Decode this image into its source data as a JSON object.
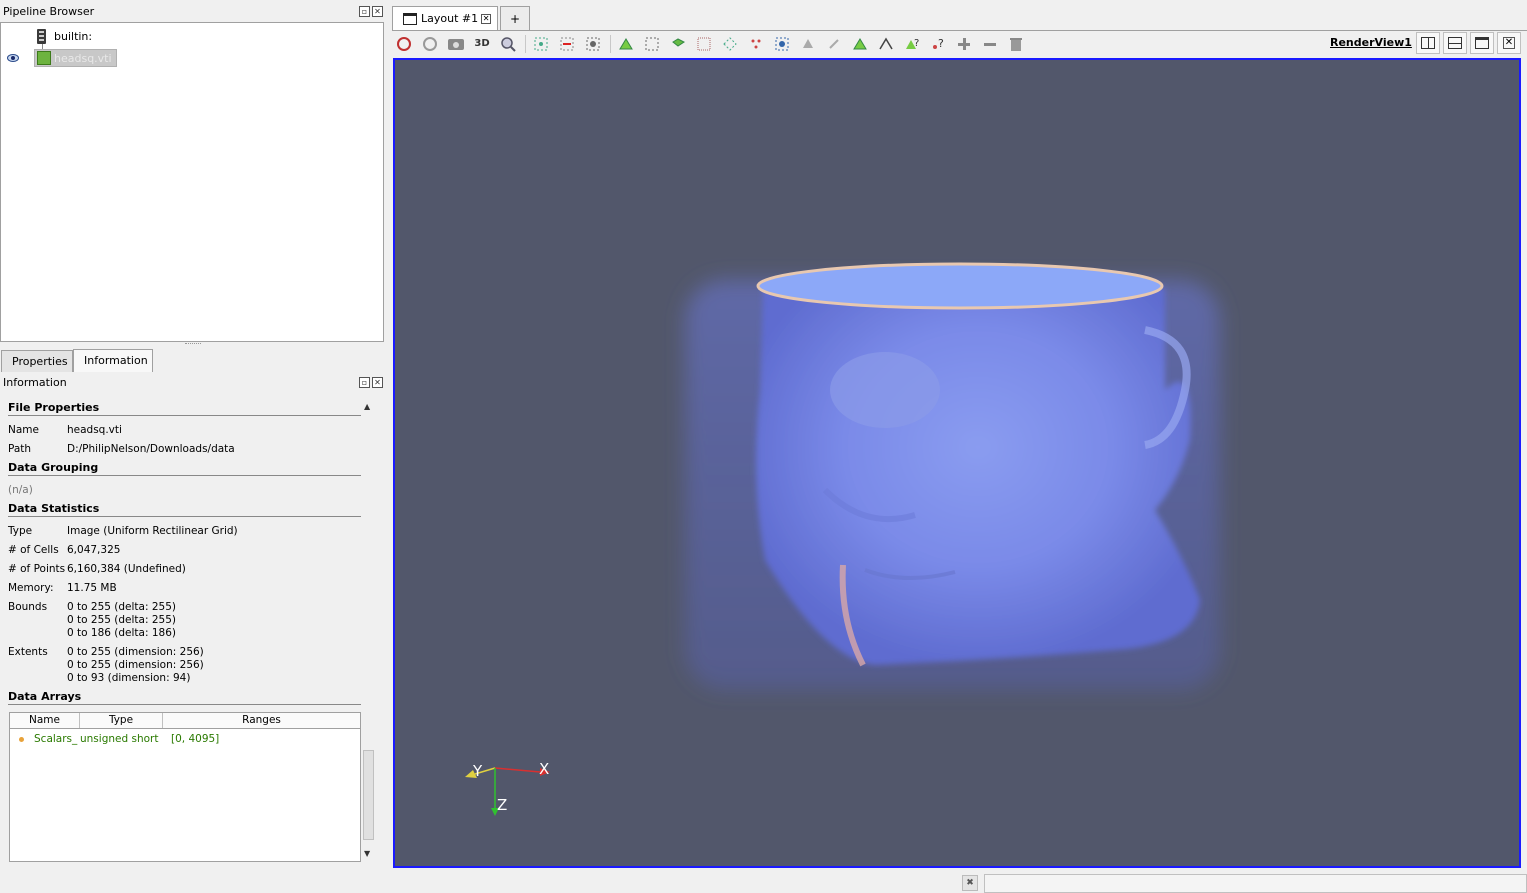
{
  "pipeline_browser": {
    "title": "Pipeline Browser",
    "server": "builtin:",
    "source": "headsq.vti"
  },
  "tabs": {
    "properties": "Properties",
    "information": "Information"
  },
  "information": {
    "title": "Information",
    "file_properties": {
      "heading": "File Properties",
      "name_label": "Name",
      "name_value": "headsq.vti",
      "path_label": "Path",
      "path_value": "D:/PhilipNelson/Downloads/data"
    },
    "data_grouping": {
      "heading": "Data Grouping",
      "value": "(n/a)"
    },
    "data_statistics": {
      "heading": "Data Statistics",
      "type_label": "Type",
      "type_value": "Image (Uniform Rectilinear Grid)",
      "cells_label": "# of Cells",
      "cells_value": "6,047,325",
      "points_label": "# of Points",
      "points_value": "6,160,384 (Undefined)",
      "memory_label": "Memory:",
      "memory_value": "11.75 MB",
      "bounds_label": "Bounds",
      "bounds": [
        "0 to 255 (delta: 255)",
        "0 to 255 (delta: 255)",
        "0 to 186 (delta: 186)"
      ],
      "extents_label": "Extents",
      "extents": [
        "0 to 255 (dimension: 256)",
        "0 to 255 (dimension: 256)",
        "0 to 93 (dimension: 94)"
      ]
    },
    "data_arrays": {
      "heading": "Data Arrays",
      "columns": [
        "Name",
        "Type",
        "Ranges"
      ],
      "rows": [
        {
          "name": "Scalars_",
          "type": "unsigned short",
          "range": "[0, 4095]"
        }
      ]
    }
  },
  "layout": {
    "tab_label": "Layout #1",
    "add_tab": "+",
    "view_name": "RenderView1",
    "toolbar_3d": "3D"
  },
  "axes": {
    "x": "X",
    "y": "Y",
    "z": "Z"
  }
}
